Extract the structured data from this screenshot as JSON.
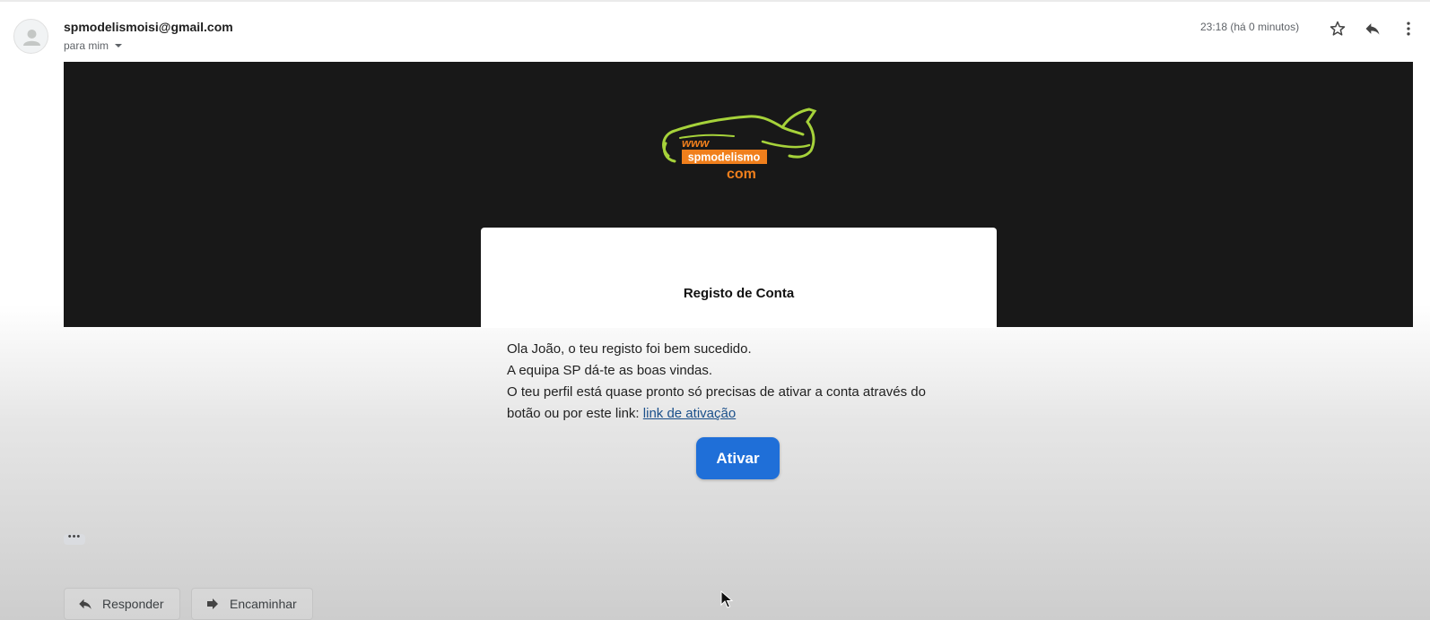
{
  "header": {
    "sender": "spmodelismoisi@gmail.com",
    "to_me": "para mim",
    "time": "23:18 (há 0 minutos)",
    "icons": [
      "star-icon",
      "reply-icon",
      "more-vert-icon"
    ]
  },
  "logo": {
    "line1": "www",
    "line2": "spmodelismo",
    "line3": "com",
    "colors": {
      "outline": "#a6d23a",
      "text": "#f07f1c"
    }
  },
  "email": {
    "title": "Registo de Conta",
    "line1": "Ola João, o teu registo foi bem sucedido.",
    "line2": "A equipa SP dá-te as boas vindas.",
    "line3": "O teu perfil está quase pronto só precisas de ativar a conta através do",
    "line4_prefix": "botão ou por este link:",
    "link_text": "link de ativação",
    "button_label": "Ativar",
    "button_color": "#1f6fd8"
  },
  "footer": {
    "ellipsis": "•••",
    "reply_label": "Responder",
    "forward_label": "Encaminhar"
  }
}
